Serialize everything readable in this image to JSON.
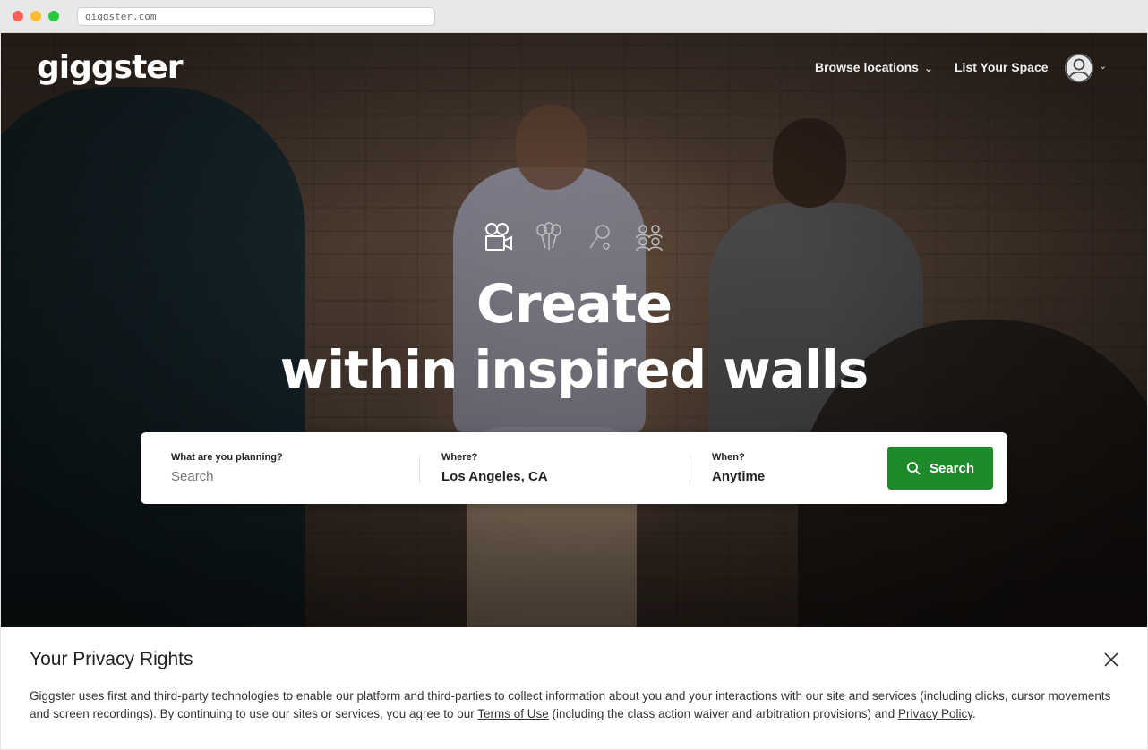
{
  "browser": {
    "url": "giggster.com"
  },
  "nav": {
    "logo": "giggster",
    "browse_label": "Browse locations",
    "list_label": "List Your Space",
    "avatar_icon": "user-circle-icon"
  },
  "hero": {
    "categories": [
      "video-camera-icon",
      "balloons-icon",
      "microphone-icon",
      "people-group-icon"
    ],
    "headline_line1": "Create",
    "headline_line2": "within inspired walls"
  },
  "search": {
    "what_label": "What are you planning?",
    "what_placeholder": "Search",
    "where_label": "Where?",
    "where_value": "Los Angeles, CA",
    "when_label": "When?",
    "when_value": "Anytime",
    "button_label": "Search",
    "button_color": "#1e8a2c"
  },
  "privacy": {
    "title": "Your Privacy Rights",
    "text_before": "Giggster uses first and third-party technologies to enable our platform and third-parties to collect information about you and your interactions with our site and services (including clicks, cursor movements and screen recordings). By continuing to use our sites or services, you agree to our ",
    "terms_link": "Terms of Use",
    "text_middle": " (including the class action waiver and arbitration provisions) and ",
    "policy_link": "Privacy Policy",
    "text_after": "."
  }
}
